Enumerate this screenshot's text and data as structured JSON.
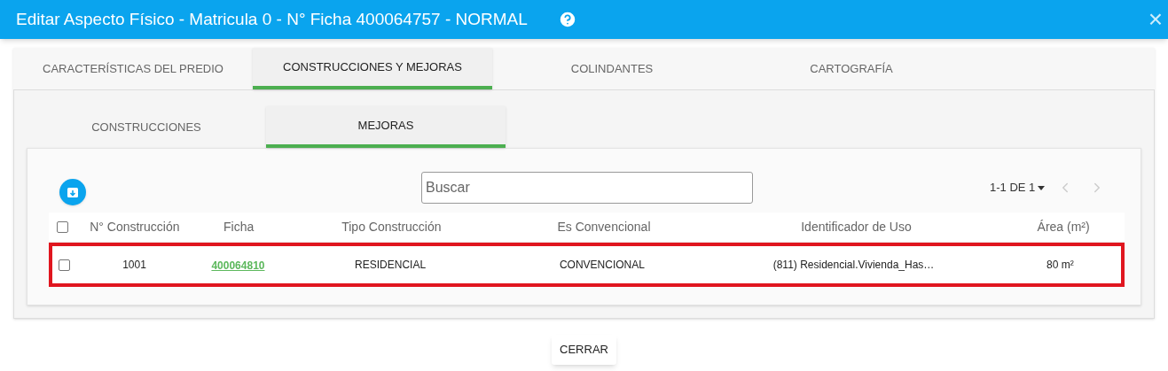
{
  "window": {
    "title": "Editar Aspecto Físico - Matricula 0 - N° Ficha 400064757 - NORMAL",
    "close_glyph": "×"
  },
  "tabs": [
    {
      "label": "CARACTERÍSTICAS DEL PREDIO",
      "selected": false
    },
    {
      "label": "CONSTRUCCIONES Y MEJORAS",
      "selected": true
    },
    {
      "label": "COLINDANTES",
      "selected": false
    },
    {
      "label": "CARTOGRAFÍA",
      "selected": false
    }
  ],
  "subtabs": [
    {
      "label": "CONSTRUCCIONES",
      "selected": false
    },
    {
      "label": "MEJORAS",
      "selected": true
    }
  ],
  "search": {
    "placeholder": "Buscar"
  },
  "pagination": {
    "range": "1-1 DE 1"
  },
  "table": {
    "select_all": {
      "checked": false
    },
    "columns": [
      "N° Construcción",
      "Ficha",
      "Tipo Construcción",
      "Es Convencional",
      "Identificador de Uso",
      "Área (m²)"
    ],
    "rows": [
      {
        "selected": true,
        "checked": false,
        "cells": [
          "1001",
          "400064810",
          "RESIDENCIAL",
          "CONVENCIONAL",
          "(811) Residencial.Vivienda_Has…",
          "80 m²"
        ]
      }
    ]
  },
  "buttons": [
    "CERRAR"
  ]
}
